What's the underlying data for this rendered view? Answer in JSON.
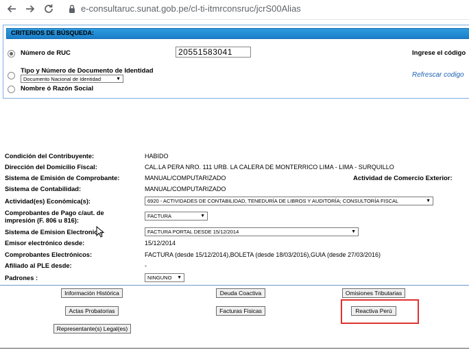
{
  "browser": {
    "url": "e-consultaruc.sunat.gob.pe/cl-ti-itmrconsruc/jcrS00Alias"
  },
  "criteria": {
    "header": "CRITERIOS DE BÚSQUEDA:",
    "ruc_label": "Número de RUC",
    "ruc_value": "20551583041",
    "captcha_label": "Ingrese el código",
    "doc_label": "Tipo y Número de Documento de Identidad",
    "doc_select": "Documento Nacional de Identidad",
    "refresh_link": "Refrescar codigo",
    "name_label": "Nombre ó Razón Social"
  },
  "details": {
    "condicion_label": "Condición del Contribuyente:",
    "condicion_value": "HABIDO",
    "direccion_label": "Dirección del Domicilio Fiscal:",
    "direccion_value": "CAL.LA PERA NRO. 111 URB. LA CALERA DE MONTERRICO LIMA - LIMA - SURQUILLO",
    "emision_label": "Sistema de Emisión de Comprobante:",
    "emision_value": "MANUAL/COMPUTARIZADO",
    "comercio_label": "Actividad de Comercio Exterior:",
    "contabilidad_label": "Sistema de Contabilidad:",
    "contabilidad_value": "MANUAL/COMPUTARIZADO",
    "actividad_label": "Actividad(es) Económica(s):",
    "actividad_value": "6920 - ACTIVIDADES DE CONTABILIDAD, TENEDURÍA DE LIBROS Y AUDITORÍA; CONSULTORÍA FISCAL",
    "comprobantes_label_1": "Comprobantes de Pago c/aut. de",
    "comprobantes_label_2": "impresión (F. 806 u 816):",
    "comprobantes_value": "FACTURA",
    "sist_electronica_label": "Sistema de Emision Electronica:",
    "sist_electronica_value": "FACTURA PORTAL DESDE 15/12/2014",
    "emisor_label": "Emisor electrónico desde:",
    "emisor_value": "15/12/2014",
    "comp_electronicos_label": "Comprobantes Electrónicos:",
    "comp_electronicos_value": "FACTURA (desde 15/12/2014),BOLETA (desde 18/03/2016),GUIA (desde 27/03/2016)",
    "ple_label": "Afiliado al PLE desde:",
    "ple_value": "-",
    "padrones_label": "Padrones :",
    "padrones_value": "NINGUNO"
  },
  "buttons": {
    "historica": "Información Histórica",
    "deuda": "Deuda Coactiva",
    "omisiones": "Omisiones Tributarias",
    "actas": "Actas Probatorias",
    "facturas": "Facturas Fisicas",
    "reactiva": "Reactiva Perú",
    "representante": "Representante(s) Legal(es)"
  }
}
